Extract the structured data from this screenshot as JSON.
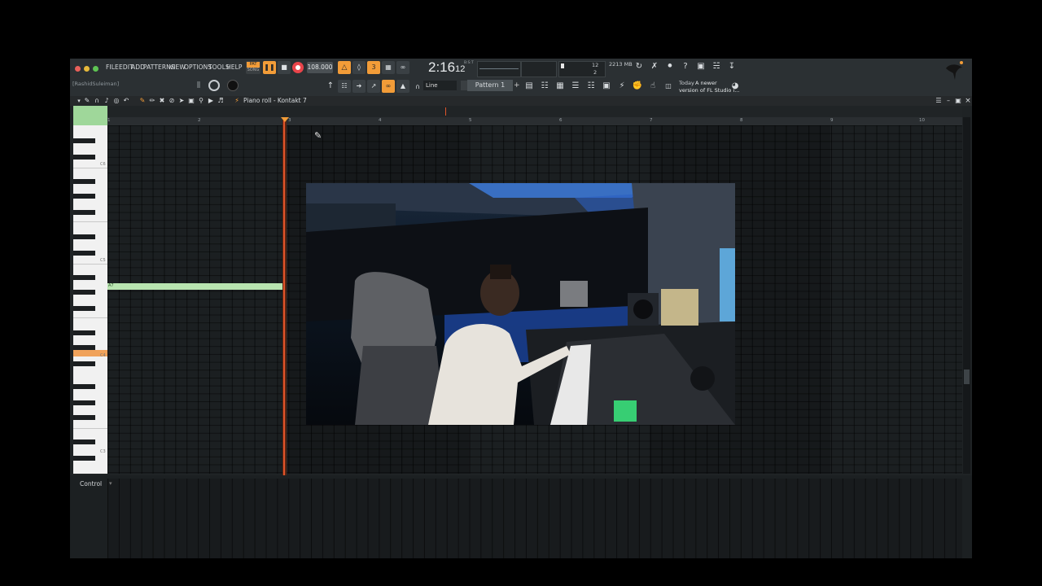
{
  "window": {
    "menu": [
      "FILE",
      "EDIT",
      "ADD",
      "PATTERNS",
      "VIEW",
      "OPTIONS",
      "TOOLS",
      "HELP"
    ],
    "hint_user": "[RashidSuleiman]",
    "mode_top": "PAT",
    "mode_bottom": "SONG",
    "tempo": "108.000",
    "time_main": "2:16",
    "time_sub": "12",
    "time_unit": "B:S:T",
    "cpu_value": "12",
    "memory": "2213 MB",
    "poly": "2",
    "snap": "Line",
    "pattern": "Pattern 1",
    "news_today": "Today",
    "news_line1": "A newer",
    "news_line2": "version of FL Studio i..."
  },
  "piano_roll": {
    "title": "Piano roll - Kontakt 7",
    "bars": [
      "1",
      "2",
      "3",
      "4",
      "5",
      "6",
      "7",
      "8",
      "9",
      "10"
    ],
    "octave_labels": [
      "C6",
      "C5",
      "C4",
      "C3"
    ],
    "note_label": "A7",
    "control_label": "Control",
    "accent": "#f29c38",
    "playhead_color": "#e0542a",
    "note_color": "#b8e4b0"
  }
}
